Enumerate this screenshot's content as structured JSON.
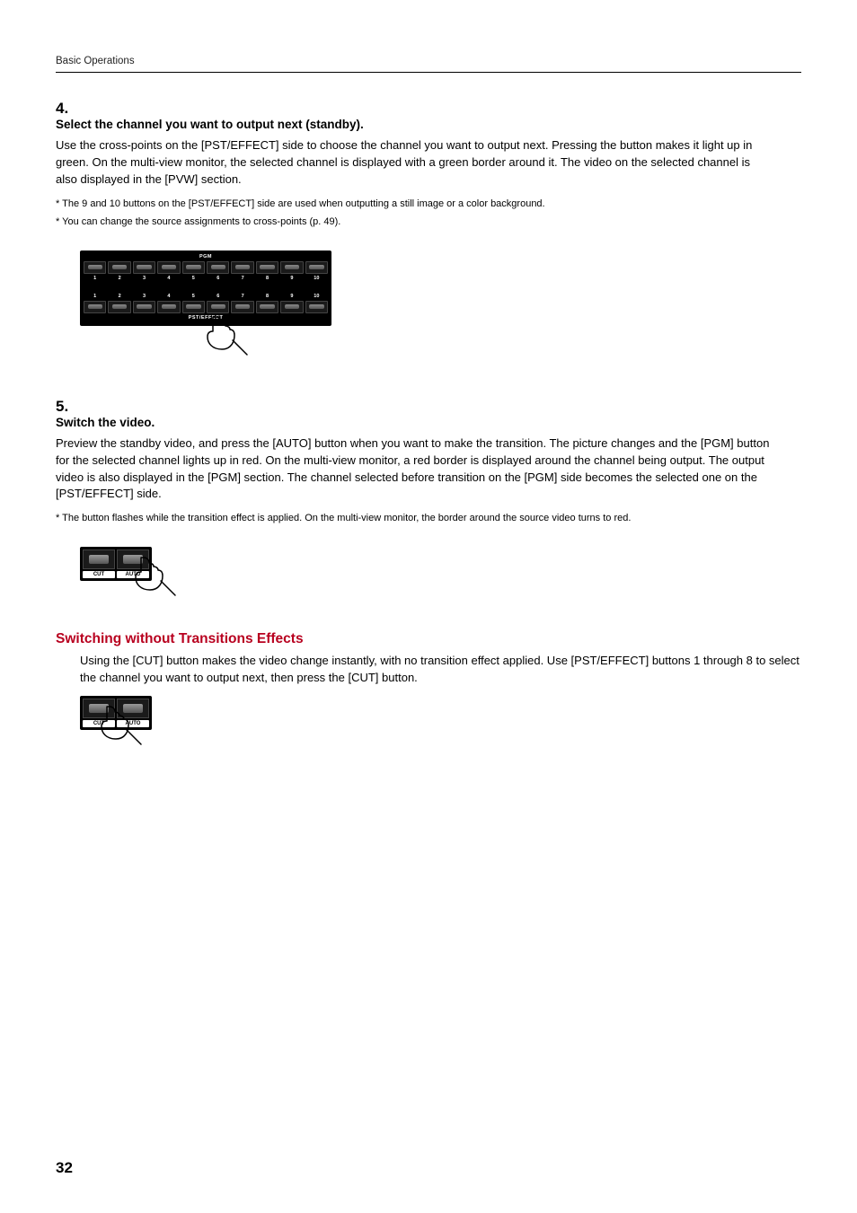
{
  "header": {
    "section": "Basic Operations"
  },
  "step4": {
    "num": "4.",
    "title": "Select the channel you want to output next (standby).",
    "body": "Use the cross-points on the [PST/EFFECT] side to choose the channel you want to output next. Pressing the button makes it light up in green. On the multi-view monitor, the selected channel is displayed with a green border around it. The video on the selected channel is also displayed in the [PVW] section.",
    "note1": "The 9 and 10 buttons on the [PST/EFFECT] side are used when outputting a still image or a color background.",
    "note2": "You can change the source assignments to cross-points (p. 49)."
  },
  "crosspoint": {
    "pgm_label": "PGM",
    "pst_label": "PST/EFFECT",
    "numbers": [
      "1",
      "2",
      "3",
      "4",
      "5",
      "6",
      "7",
      "8",
      "9",
      "10"
    ]
  },
  "step5": {
    "num": "5.",
    "title": "Switch the video.",
    "body": "Preview the standby video, and press the [AUTO] button when you want to make the transition. The picture changes and the [PGM] button for the selected channel lights up in red. On the multi-view monitor, a red border is displayed around the channel being output. The output video is also displayed in the [PGM] section. The channel selected before transition on the [PGM] side becomes the selected one on the [PST/EFFECT] side.",
    "note1": "The button flashes while the transition effect is applied. On the multi-view monitor, the border around the source video turns to red."
  },
  "cutauto": {
    "cut": "CUT",
    "auto": "AUTO"
  },
  "subsection": {
    "heading": "Switching without Transitions Effects",
    "body": "Using the [CUT] button makes the video change instantly, with no transition effect applied. Use [PST/EFFECT] buttons 1 through 8 to select the channel you want to output next, then press the [CUT] button."
  },
  "page": "32"
}
